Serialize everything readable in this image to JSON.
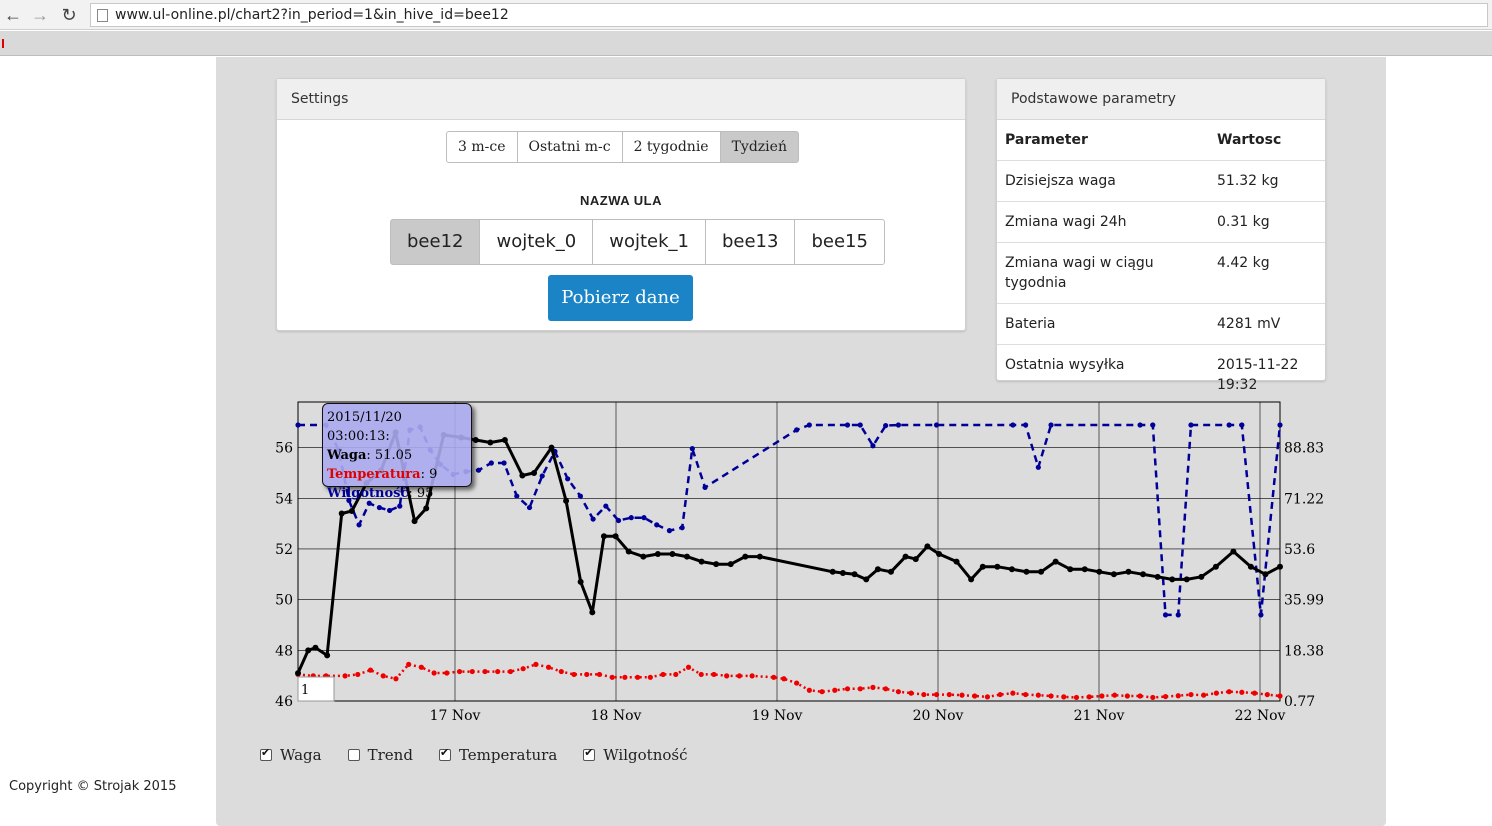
{
  "browser": {
    "back_icon": "arrow-left-icon",
    "forward_icon": "arrow-right-icon",
    "reload_icon": "reload-icon",
    "url": "www.ul-online.pl/chart2?in_period=1&in_hive_id=bee12"
  },
  "settings": {
    "title": "Settings",
    "periods": [
      "3 m-ce",
      "Ostatni m-c",
      "2 tygodnie",
      "Tydzień"
    ],
    "active_period": "Tydzień",
    "hive_label": "NAZWA ULA",
    "hives": [
      "bee12",
      "wojtek_0",
      "wojtek_1",
      "bee13",
      "bee15"
    ],
    "active_hive": "bee12",
    "fetch_button": "Pobierz dane"
  },
  "params": {
    "title": "Podstawowe parametry",
    "col_param": "Parameter",
    "col_value": "Wartosc",
    "rows": [
      {
        "name": "Dzisiejsza waga",
        "value": "51.32 kg"
      },
      {
        "name": "Zmiana wagi 24h",
        "value": "0.31 kg"
      },
      {
        "name": "Zmiana wagi w ciągu tygodnia",
        "value": "4.42 kg"
      },
      {
        "name": "Bateria",
        "value": "4281 mV"
      },
      {
        "name": "Ostatnia wysyłka",
        "value": "2015-11-22 19:32"
      }
    ]
  },
  "tooltip": {
    "date": "2015/11/20 03:00:13:",
    "waga_label": "Waga",
    "waga_value": ": 51.05",
    "temp_label": "Temperatura",
    "temp_value": ": 9",
    "wilg_label": "Wilgotność",
    "wilg_value": ": 95"
  },
  "legend": {
    "waga": {
      "label": "Waga",
      "checked": true
    },
    "trend": {
      "label": "Trend",
      "checked": false
    },
    "temp": {
      "label": "Temperatura",
      "checked": true
    },
    "wilg": {
      "label": "Wilgotność",
      "checked": true
    }
  },
  "copyright": "Copyright © Strojak 2015",
  "chart_data": {
    "type": "line",
    "x_labels": [
      "17 Nov",
      "18 Nov",
      "19 Nov",
      "20 Nov",
      "21 Nov",
      "22 Nov"
    ],
    "x_range_days": [
      16.98,
      23.0
    ],
    "y_left": {
      "ticks": [
        "56",
        "54",
        "52",
        "50",
        "48",
        "46"
      ],
      "range": [
        46,
        57.8
      ]
    },
    "y_right": {
      "ticks": [
        "88.83",
        "71.22",
        "53.6",
        "35.99",
        "18.38",
        "0.77"
      ],
      "range": [
        0.77,
        104.7
      ]
    },
    "range_input_value": "1",
    "colors": {
      "waga": "#000000",
      "temp": "#ee0000",
      "wilg": "#000099"
    },
    "series": [
      {
        "name": "Waga",
        "axis": "left",
        "style": "solid",
        "points": [
          [
            16.98,
            47.1
          ],
          [
            17.05,
            48.0
          ],
          [
            17.1,
            48.1
          ],
          [
            17.18,
            47.8
          ],
          [
            17.28,
            53.4
          ],
          [
            17.35,
            53.5
          ],
          [
            17.45,
            54.6
          ],
          [
            17.55,
            55.1
          ],
          [
            17.65,
            56.6
          ],
          [
            17.78,
            53.1
          ],
          [
            17.86,
            53.6
          ],
          [
            17.98,
            56.5
          ],
          [
            18.1,
            56.4
          ],
          [
            18.2,
            56.3
          ],
          [
            18.3,
            56.2
          ],
          [
            18.4,
            56.3
          ],
          [
            18.52,
            54.9
          ],
          [
            18.6,
            55.0
          ],
          [
            18.72,
            56.0
          ],
          [
            18.82,
            53.9
          ],
          [
            18.92,
            50.7
          ],
          [
            19.0,
            49.5
          ],
          [
            19.08,
            52.5
          ],
          [
            19.16,
            52.5
          ],
          [
            19.25,
            51.9
          ],
          [
            19.35,
            51.7
          ],
          [
            19.45,
            51.8
          ],
          [
            19.55,
            51.8
          ],
          [
            19.65,
            51.7
          ],
          [
            19.75,
            51.5
          ],
          [
            19.85,
            51.4
          ],
          [
            19.95,
            51.4
          ],
          [
            20.05,
            51.7
          ],
          [
            20.15,
            51.7
          ],
          [
            20.65,
            51.1
          ],
          [
            20.72,
            51.05
          ],
          [
            20.8,
            51.0
          ],
          [
            20.88,
            50.8
          ],
          [
            20.96,
            51.2
          ],
          [
            21.05,
            51.1
          ],
          [
            21.15,
            51.7
          ],
          [
            21.22,
            51.6
          ],
          [
            21.3,
            52.1
          ],
          [
            21.38,
            51.8
          ],
          [
            21.5,
            51.5
          ],
          [
            21.6,
            50.8
          ],
          [
            21.68,
            51.3
          ],
          [
            21.78,
            51.3
          ],
          [
            21.88,
            51.2
          ],
          [
            21.98,
            51.1
          ],
          [
            22.08,
            51.1
          ],
          [
            22.18,
            51.5
          ],
          [
            22.28,
            51.2
          ],
          [
            22.38,
            51.2
          ],
          [
            22.48,
            51.1
          ],
          [
            22.58,
            51.0
          ],
          [
            22.68,
            51.1
          ],
          [
            22.78,
            51.0
          ],
          [
            22.88,
            50.9
          ],
          [
            22.98,
            50.8
          ],
          [
            23.08,
            50.8
          ],
          [
            23.18,
            50.9
          ],
          [
            23.28,
            51.3
          ],
          [
            23.4,
            51.9
          ],
          [
            23.52,
            51.3
          ],
          [
            23.62,
            51.0
          ],
          [
            23.72,
            51.3
          ]
        ]
      },
      {
        "name": "Temperatura",
        "axis": "right",
        "style": "dashed",
        "points": [
          [
            16.98,
            10.0
          ],
          [
            17.1,
            9.5
          ],
          [
            17.2,
            9.5
          ],
          [
            17.35,
            9.5
          ],
          [
            17.45,
            10
          ],
          [
            17.55,
            11.5
          ],
          [
            17.65,
            9.5
          ],
          [
            17.75,
            8.5
          ],
          [
            17.85,
            13.5
          ],
          [
            17.95,
            12.5
          ],
          [
            18.05,
            10.5
          ],
          [
            18.15,
            10.5
          ],
          [
            18.25,
            11
          ],
          [
            18.35,
            11
          ],
          [
            18.45,
            11
          ],
          [
            18.55,
            11
          ],
          [
            18.65,
            11
          ],
          [
            18.75,
            12
          ],
          [
            18.85,
            13.5
          ],
          [
            18.95,
            12.5
          ],
          [
            19.05,
            11
          ],
          [
            19.15,
            10
          ],
          [
            19.25,
            10
          ],
          [
            19.35,
            10
          ],
          [
            19.45,
            9
          ],
          [
            19.55,
            9
          ],
          [
            19.65,
            9
          ],
          [
            19.75,
            9
          ],
          [
            19.85,
            10
          ],
          [
            19.95,
            10
          ],
          [
            20.05,
            12.5
          ],
          [
            20.15,
            10
          ],
          [
            20.25,
            10
          ],
          [
            20.35,
            9.5
          ],
          [
            20.45,
            9.5
          ],
          [
            20.55,
            9.5
          ],
          [
            20.72,
            9.0
          ],
          [
            20.8,
            8.5
          ],
          [
            20.9,
            7.0
          ],
          [
            21.0,
            4.5
          ],
          [
            21.1,
            4.0
          ],
          [
            21.2,
            4.5
          ],
          [
            21.3,
            5.0
          ],
          [
            21.4,
            5.0
          ],
          [
            21.5,
            5.5
          ],
          [
            21.6,
            5.0
          ],
          [
            21.7,
            4.0
          ],
          [
            21.8,
            3.5
          ],
          [
            21.9,
            3.0
          ],
          [
            22.0,
            3.0
          ],
          [
            22.1,
            3.0
          ],
          [
            22.2,
            2.8
          ],
          [
            22.3,
            2.5
          ],
          [
            22.4,
            2.2
          ],
          [
            22.5,
            3.0
          ],
          [
            22.6,
            3.5
          ],
          [
            22.7,
            3.0
          ],
          [
            22.8,
            2.8
          ],
          [
            22.9,
            2.5
          ],
          [
            23.0,
            2.2
          ],
          [
            23.1,
            2.0
          ],
          [
            23.2,
            2.2
          ],
          [
            23.3,
            2.5
          ],
          [
            23.4,
            2.8
          ],
          [
            23.5,
            2.5
          ],
          [
            23.6,
            2.5
          ],
          [
            23.7,
            2.0
          ],
          [
            23.8,
            2.3
          ],
          [
            23.9,
            2.6
          ],
          [
            24.0,
            3.0
          ],
          [
            24.1,
            2.8
          ],
          [
            24.2,
            3.5
          ],
          [
            24.3,
            4.0
          ],
          [
            24.4,
            3.8
          ],
          [
            24.5,
            3.5
          ],
          [
            24.6,
            3.0
          ],
          [
            24.7,
            2.5
          ]
        ]
      },
      {
        "name": "Wilgotność",
        "axis": "right",
        "style": "dashed",
        "points": [
          [
            16.98,
            96.7
          ],
          [
            17.2,
            96.7
          ],
          [
            17.3,
            88.0
          ],
          [
            17.38,
            70.5
          ],
          [
            17.46,
            62.0
          ],
          [
            17.54,
            69.5
          ],
          [
            17.62,
            68.0
          ],
          [
            17.7,
            67.0
          ],
          [
            17.78,
            68.5
          ],
          [
            17.86,
            95.0
          ],
          [
            17.94,
            96.0
          ],
          [
            18.02,
            88.0
          ],
          [
            18.1,
            83.0
          ],
          [
            18.2,
            79.5
          ],
          [
            18.3,
            80.5
          ],
          [
            18.4,
            81.0
          ],
          [
            18.5,
            83.5
          ],
          [
            18.6,
            83.5
          ],
          [
            18.7,
            72.0
          ],
          [
            18.8,
            68.0
          ],
          [
            18.9,
            79.0
          ],
          [
            19.0,
            87.5
          ],
          [
            19.1,
            78.0
          ],
          [
            19.2,
            72.0
          ],
          [
            19.3,
            64.0
          ],
          [
            19.4,
            68.5
          ],
          [
            19.5,
            63.5
          ],
          [
            19.6,
            64.5
          ],
          [
            19.7,
            64.5
          ],
          [
            19.8,
            62.0
          ],
          [
            19.9,
            60.0
          ],
          [
            20.0,
            61.0
          ],
          [
            20.08,
            88.5
          ],
          [
            20.18,
            75.0
          ],
          [
            20.9,
            95.0
          ],
          [
            21.0,
            96.7
          ],
          [
            21.3,
            96.7
          ],
          [
            21.4,
            96.7
          ],
          [
            21.5,
            89.5
          ],
          [
            21.6,
            96.5
          ],
          [
            21.7,
            96.7
          ],
          [
            22.0,
            96.7
          ],
          [
            22.6,
            96.7
          ],
          [
            22.7,
            96.7
          ],
          [
            22.8,
            82.0
          ],
          [
            22.9,
            96.7
          ],
          [
            23.6,
            96.7
          ],
          [
            23.7,
            96.7
          ],
          [
            23.8,
            30.7
          ],
          [
            23.9,
            30.7
          ],
          [
            24.0,
            96.7
          ],
          [
            24.3,
            96.7
          ],
          [
            24.4,
            96.7
          ],
          [
            24.55,
            30.7
          ],
          [
            24.7,
            96.7
          ]
        ]
      }
    ]
  }
}
